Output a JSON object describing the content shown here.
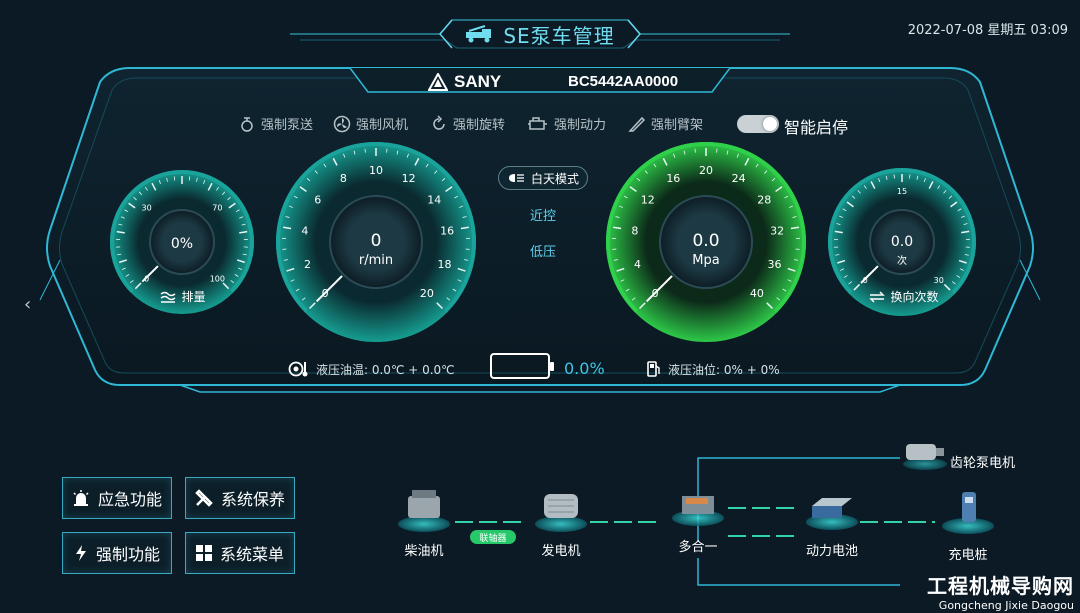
{
  "header": {
    "title": "SE泵车管理",
    "datetime": "2022-07-08 星期五 03:09"
  },
  "brand": {
    "logo_text": "SANY",
    "vehicle_id": "BC5442AA0000"
  },
  "controls": [
    {
      "label": "强制泵送",
      "icon": "pump-icon"
    },
    {
      "label": "强制风机",
      "icon": "fan-icon"
    },
    {
      "label": "强制旋转",
      "icon": "rotate-icon"
    },
    {
      "label": "强制动力",
      "icon": "engine-icon"
    },
    {
      "label": "强制臂架",
      "icon": "boom-icon"
    }
  ],
  "smart_stop": {
    "label": "智能启停",
    "on": true
  },
  "mode": {
    "button": "白天模式",
    "control_mode": "近控",
    "pressure_mode": "低压"
  },
  "gauges": {
    "displacement": {
      "value": "0%",
      "caption": "排量",
      "ticks": [
        "0",
        "30",
        "70",
        "100"
      ],
      "level": 0
    },
    "rpm": {
      "value": "0",
      "unit": "r/min",
      "ticks": [
        "0",
        "2",
        "4",
        "6",
        "8",
        "10",
        "12",
        "14",
        "16",
        "18",
        "20"
      ],
      "level": 0
    },
    "pressure": {
      "value": "0.0",
      "unit": "Mpa",
      "ticks": [
        "0",
        "4",
        "8",
        "12",
        "16",
        "20",
        "24",
        "28",
        "32",
        "36",
        "40"
      ],
      "level": 0
    },
    "switch_count": {
      "value": "0.0",
      "unit": "次",
      "caption": "换向次数",
      "ticks": [
        "0",
        "15",
        "30"
      ],
      "level": 0
    }
  },
  "status": {
    "oil_temp": "液压油温: 0.0℃ + 0.0℃",
    "battery_pct": "0.0%",
    "oil_level": "液压油位: 0% + 0%"
  },
  "menu": {
    "emergency": "应急功能",
    "maintenance": "系统保养",
    "force": "强制功能",
    "system_menu": "系统菜单"
  },
  "powertrain": {
    "diesel": "柴油机",
    "coupler": "联轴器",
    "generator": "发电机",
    "combiner": "多合一",
    "battery": "动力电池",
    "charger": "充电桩",
    "gear_pump_motor": "齿轮泵电机"
  },
  "watermark": {
    "cn": "工程机械导购网",
    "en": "Gongcheng Jixie Daogou"
  },
  "colors": {
    "accent": "#3ec4e4",
    "teal_gauge": "#1aa39a",
    "green_gauge": "#2fd14a",
    "bg": "#0b1a24"
  }
}
